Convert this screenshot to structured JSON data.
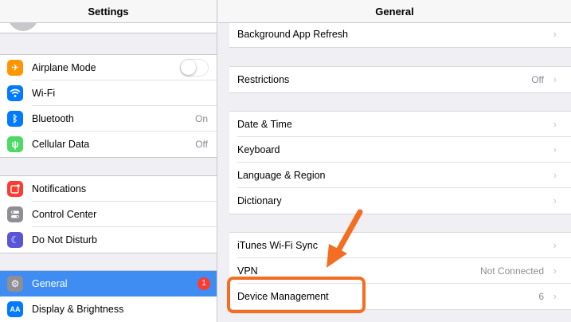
{
  "left": {
    "title": "Settings",
    "groups": [
      [
        {
          "label": "Airplane Mode",
          "icon": "airplane-icon",
          "color": "#ff9500",
          "glyph": "✈"
        },
        {
          "label": "Wi-Fi",
          "icon": "wifi-icon",
          "color": "#007aff",
          "glyph": "≋"
        },
        {
          "label": "Bluetooth",
          "icon": "bluetooth-icon",
          "color": "#007aff",
          "glyph": "ᛒ",
          "value": "On"
        },
        {
          "label": "Cellular Data",
          "icon": "antenna-icon",
          "color": "#4cd964",
          "glyph": "⍦",
          "value": "Off"
        }
      ],
      [
        {
          "label": "Notifications",
          "icon": "notifications-icon",
          "color": "#ff3b30",
          "glyph": "▣"
        },
        {
          "label": "Control Center",
          "icon": "switches-icon",
          "color": "#8e8e93",
          "glyph": "⊜"
        },
        {
          "label": "Do Not Disturb",
          "icon": "moon-icon",
          "color": "#5856d6",
          "glyph": "☾"
        }
      ],
      [
        {
          "label": "General",
          "icon": "gear-icon",
          "color": "#8e8e93",
          "glyph": "⚙",
          "badge": "1"
        },
        {
          "label": "Display & Brightness",
          "icon": "display-icon",
          "color": "#007aff",
          "glyph": "AA"
        }
      ]
    ]
  },
  "right": {
    "title": "General",
    "groups": [
      [
        {
          "label": "Background App Refresh"
        }
      ],
      [
        {
          "label": "Restrictions",
          "value": "Off"
        }
      ],
      [
        {
          "label": "Date & Time"
        },
        {
          "label": "Keyboard"
        },
        {
          "label": "Language & Region"
        },
        {
          "label": "Dictionary"
        }
      ],
      [
        {
          "label": "iTunes Wi-Fi Sync"
        },
        {
          "label": "VPN",
          "value": "Not Connected"
        },
        {
          "label": "Device Management",
          "value": "6"
        }
      ]
    ]
  },
  "accent_color": "#f36e22",
  "selected_color": "#3f8cf3"
}
